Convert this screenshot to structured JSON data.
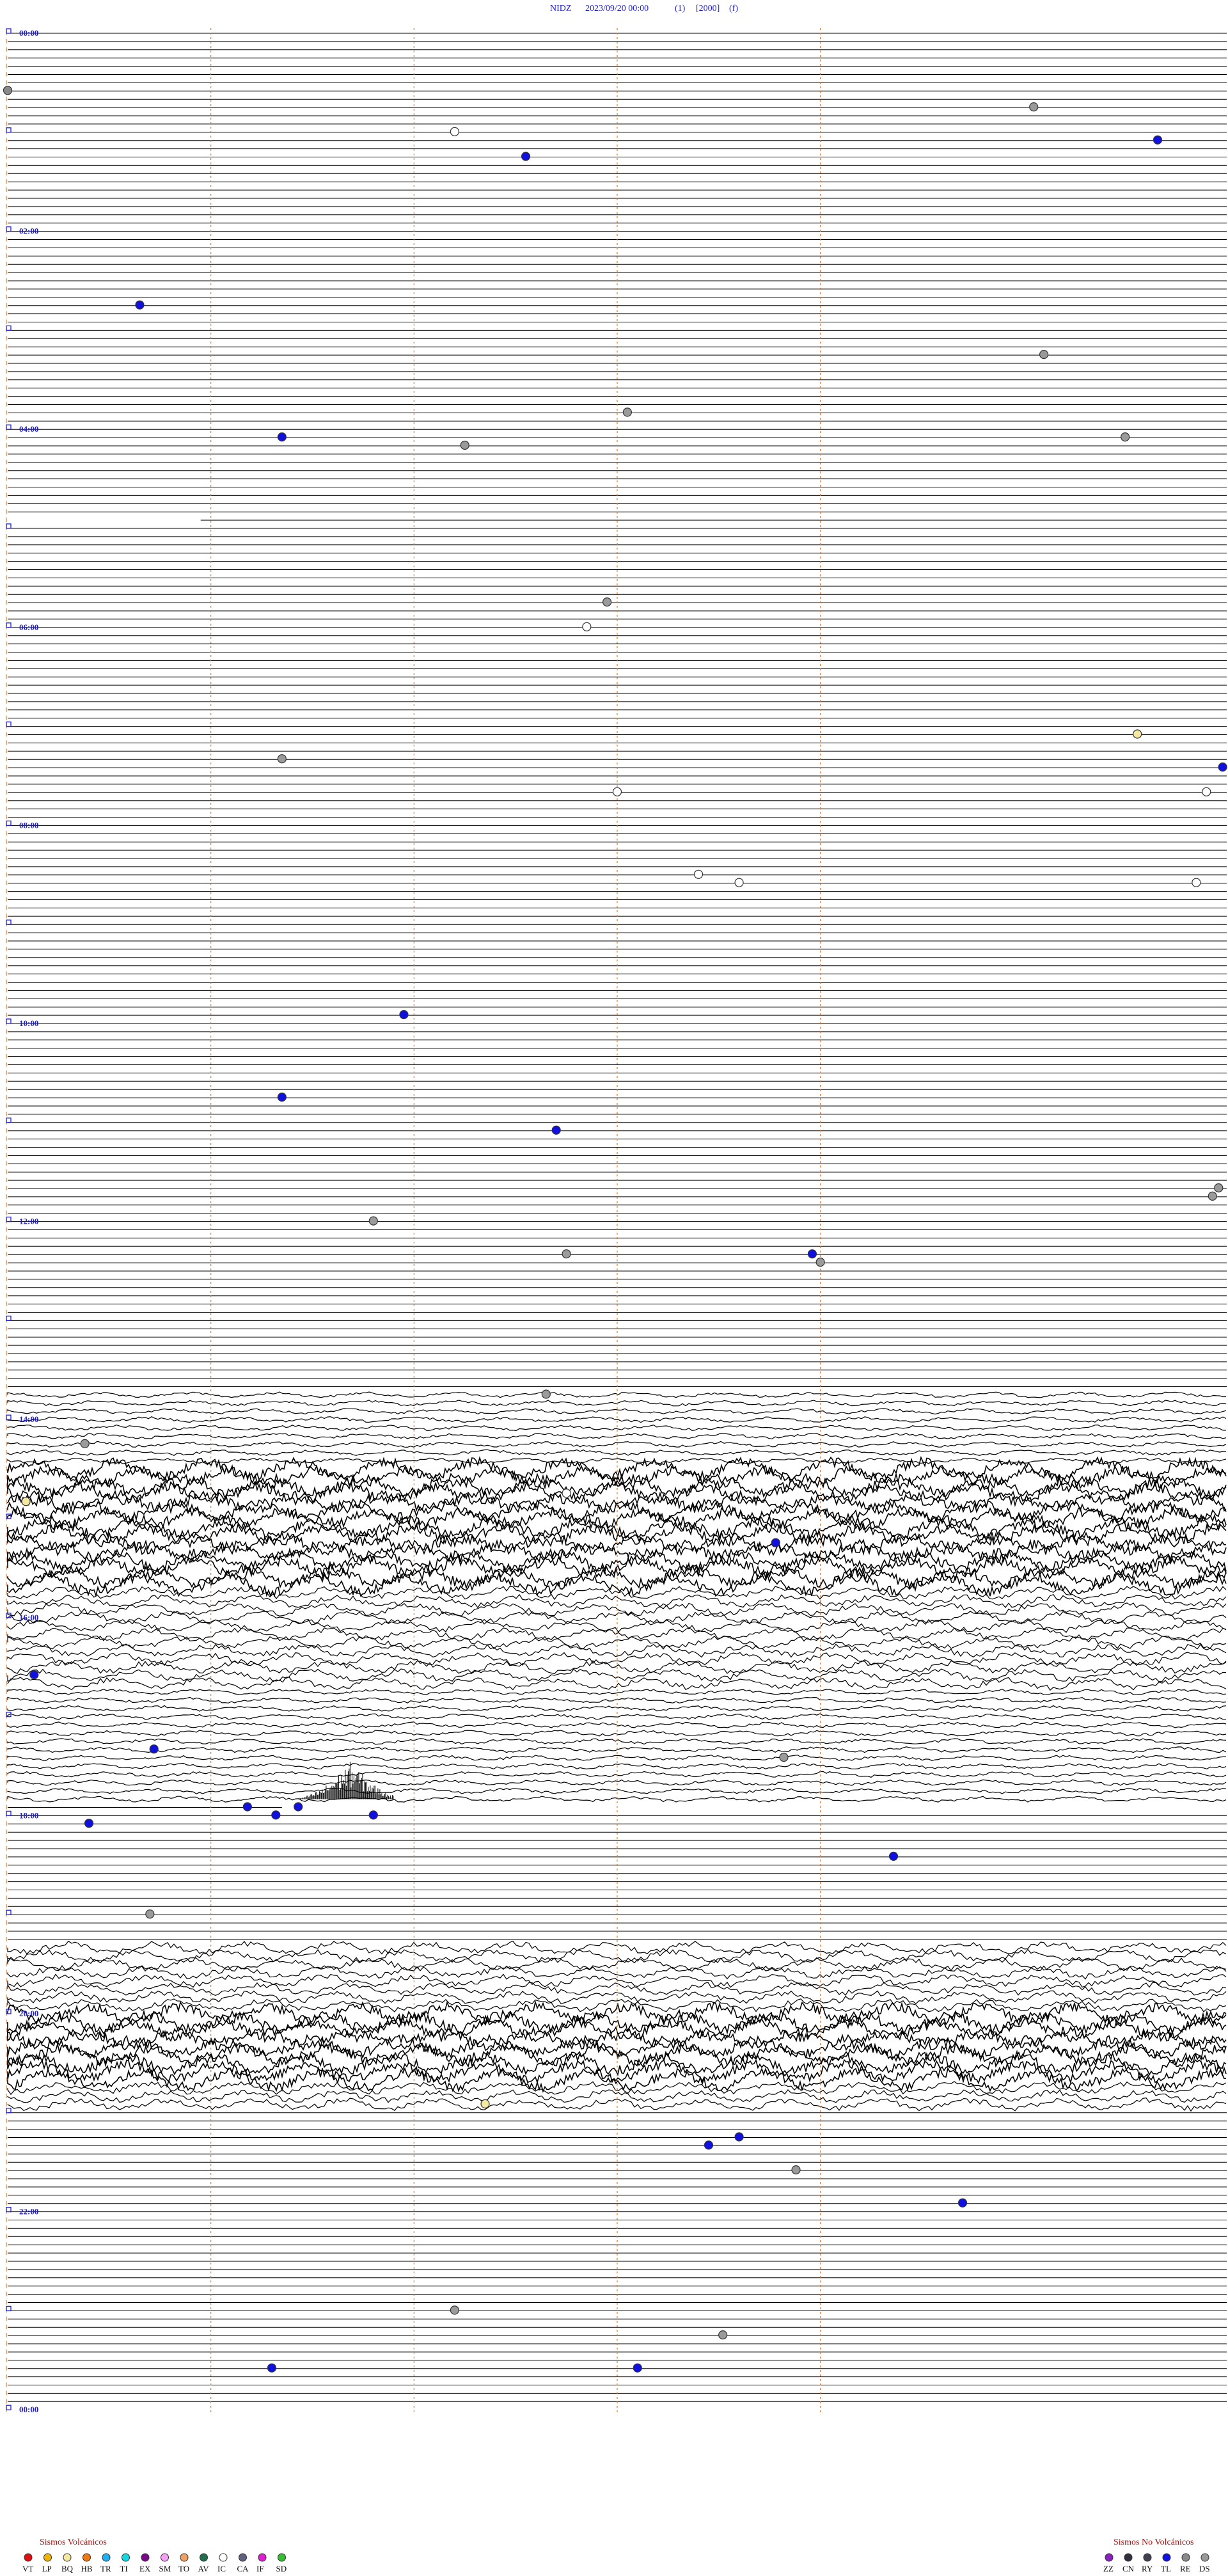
{
  "header": {
    "station": "NIDZ",
    "datetime": "2023/09/20 00:00",
    "component": "(1)",
    "scale": "[2000]",
    "filter": "(f)"
  },
  "chart_data": {
    "type": "helicorder",
    "start": "2023/09/20 00:00",
    "end": "2023/09/21 00:00",
    "minutes_per_line": 5,
    "hour_labels": [
      "00:00",
      "02:00",
      "04:00",
      "06:00",
      "08:00",
      "10:00",
      "12:00",
      "14:00",
      "16:00",
      "18:00",
      "20:00",
      "22:00",
      "00:00"
    ],
    "minute_gridlines": [
      10,
      20,
      30,
      40
    ],
    "noisy_periods": [
      {
        "start_h": 13.7,
        "end_h": 14.5,
        "level": "moderate"
      },
      {
        "start_h": 14.5,
        "end_h": 15.7,
        "level": "very high"
      },
      {
        "start_h": 15.7,
        "end_h": 16.7,
        "level": "high"
      },
      {
        "start_h": 16.7,
        "end_h": 17.9,
        "level": "moderate"
      },
      {
        "start_h": 19.3,
        "end_h": 20.0,
        "level": "high"
      },
      {
        "start_h": 20.0,
        "end_h": 20.7,
        "level": "very high"
      },
      {
        "start_h": 20.7,
        "end_h": 21.0,
        "level": "high"
      }
    ],
    "gaps": [
      {
        "line_h": 4.92,
        "from_min": 0,
        "to_min": 9.5
      },
      {
        "line_h": 17.92,
        "from_min": 13.5,
        "to_min": 60
      }
    ],
    "burst": {
      "line_h": 17.83,
      "from_min": 13.5,
      "to_min": 19
    }
  },
  "events": [
    {
      "type": "RE",
      "time_h": 0.58,
      "minute": 0.0
    },
    {
      "type": "DS",
      "time_h": 0.75,
      "minute": 50.5
    },
    {
      "type": "IC",
      "time_h": 1.0,
      "minute": 22.0
    },
    {
      "type": "TL",
      "time_h": 1.25,
      "minute": 25.5
    },
    {
      "type": "TL",
      "time_h": 1.08,
      "minute": 56.6
    },
    {
      "type": "TL",
      "time_h": 2.75,
      "minute": 6.5
    },
    {
      "type": "DS",
      "time_h": 3.25,
      "minute": 51.0
    },
    {
      "type": "DS",
      "time_h": 3.83,
      "minute": 30.5
    },
    {
      "type": "TL",
      "time_h": 4.08,
      "minute": 13.5
    },
    {
      "type": "DS",
      "time_h": 4.17,
      "minute": 22.5
    },
    {
      "type": "DS",
      "time_h": 4.08,
      "minute": 55.0
    },
    {
      "type": "DS",
      "time_h": 5.75,
      "minute": 29.5
    },
    {
      "type": "IC",
      "time_h": 6.0,
      "minute": 28.5
    },
    {
      "type": "BQ",
      "time_h": 7.08,
      "minute": 55.6
    },
    {
      "type": "DS",
      "time_h": 7.33,
      "minute": 13.5
    },
    {
      "type": "TL",
      "time_h": 7.42,
      "minute": 59.8
    },
    {
      "type": "IC",
      "time_h": 7.67,
      "minute": 30.0
    },
    {
      "type": "IC",
      "time_h": 7.67,
      "minute": 59.0
    },
    {
      "type": "IC",
      "time_h": 8.5,
      "minute": 34.0
    },
    {
      "type": "IC",
      "time_h": 8.58,
      "minute": 36.0
    },
    {
      "type": "IC",
      "time_h": 8.58,
      "minute": 58.5
    },
    {
      "type": "TL",
      "time_h": 9.92,
      "minute": 19.5
    },
    {
      "type": "TL",
      "time_h": 10.75,
      "minute": 13.5
    },
    {
      "type": "TL",
      "time_h": 11.08,
      "minute": 27.0
    },
    {
      "type": "DS",
      "time_h": 11.67,
      "minute": 59.6
    },
    {
      "type": "DS",
      "time_h": 11.75,
      "minute": 59.3
    },
    {
      "type": "DS",
      "time_h": 12.0,
      "minute": 18.0
    },
    {
      "type": "DS",
      "time_h": 12.33,
      "minute": 27.5
    },
    {
      "type": "TL",
      "time_h": 12.33,
      "minute": 39.6
    },
    {
      "type": "DS",
      "time_h": 12.42,
      "minute": 40.0
    },
    {
      "type": "DS",
      "time_h": 13.75,
      "minute": 26.5
    },
    {
      "type": "DS",
      "time_h": 14.25,
      "minute": 3.8
    },
    {
      "type": "IC",
      "time_h": 14.75,
      "minute": 27.5
    },
    {
      "type": "BQ",
      "time_h": 14.83,
      "minute": 0.9
    },
    {
      "type": "TL",
      "time_h": 15.25,
      "minute": 37.8
    },
    {
      "type": "TL",
      "time_h": 16.58,
      "minute": 1.3
    },
    {
      "type": "TL",
      "time_h": 17.33,
      "minute": 7.2
    },
    {
      "type": "DS",
      "time_h": 17.42,
      "minute": 38.2
    },
    {
      "type": "TL",
      "time_h": 17.92,
      "minute": 11.8
    },
    {
      "type": "TL",
      "time_h": 17.92,
      "minute": 14.3
    },
    {
      "type": "TL",
      "time_h": 18.0,
      "minute": 13.2
    },
    {
      "type": "TL",
      "time_h": 18.0,
      "minute": 18.0
    },
    {
      "type": "TL",
      "time_h": 18.08,
      "minute": 4.0
    },
    {
      "type": "TL",
      "time_h": 18.42,
      "minute": 43.6
    },
    {
      "type": "DS",
      "time_h": 19.0,
      "minute": 7.0
    },
    {
      "type": "BQ",
      "time_h": 20.92,
      "minute": 23.5
    },
    {
      "type": "TL",
      "time_h": 21.25,
      "minute": 36.0
    },
    {
      "type": "TL",
      "time_h": 21.33,
      "minute": 34.5
    },
    {
      "type": "DS",
      "time_h": 21.58,
      "minute": 38.8
    },
    {
      "type": "TL",
      "time_h": 21.92,
      "minute": 47.0
    },
    {
      "type": "DS",
      "time_h": 23.0,
      "minute": 22.0
    },
    {
      "type": "DS",
      "time_h": 23.25,
      "minute": 35.2
    },
    {
      "type": "TL",
      "time_h": 23.58,
      "minute": 13.0
    },
    {
      "type": "TL",
      "time_h": 23.58,
      "minute": 31.0
    }
  ],
  "legend": {
    "volcanic_title": "Sismos Volcánicos",
    "volcanic": [
      {
        "code": "VT",
        "color": "#e01010"
      },
      {
        "code": "LP",
        "color": "#f0b400"
      },
      {
        "code": "BQ",
        "color": "#f5e8a0"
      },
      {
        "code": "HB",
        "color": "#f07810"
      },
      {
        "code": "TR",
        "color": "#20b0f0"
      },
      {
        "code": "TI",
        "color": "#10d8e0"
      },
      {
        "code": "EX",
        "color": "#7a0a8a"
      },
      {
        "code": "SM",
        "color": "#f8a0f8"
      },
      {
        "code": "TO",
        "color": "#f0a060"
      },
      {
        "code": "AV",
        "color": "#1f6f4f"
      },
      {
        "code": "IC",
        "color": "#ffffff"
      },
      {
        "code": "CA",
        "color": "#606080"
      },
      {
        "code": "IF",
        "color": "#e020d0"
      },
      {
        "code": "SD",
        "color": "#30c030"
      }
    ],
    "non_volcanic_title": "Sismos No Volcánicos",
    "non_volcanic": [
      {
        "code": "ZZ",
        "color": "#8a20c0"
      },
      {
        "code": "CN",
        "color": "#303040"
      },
      {
        "code": "RY",
        "color": "#404050"
      },
      {
        "code": "TL",
        "color": "#1010e0"
      },
      {
        "code": "RE",
        "color": "#8a8a8a"
      },
      {
        "code": "DS",
        "color": "#9a9a9a"
      }
    ]
  }
}
